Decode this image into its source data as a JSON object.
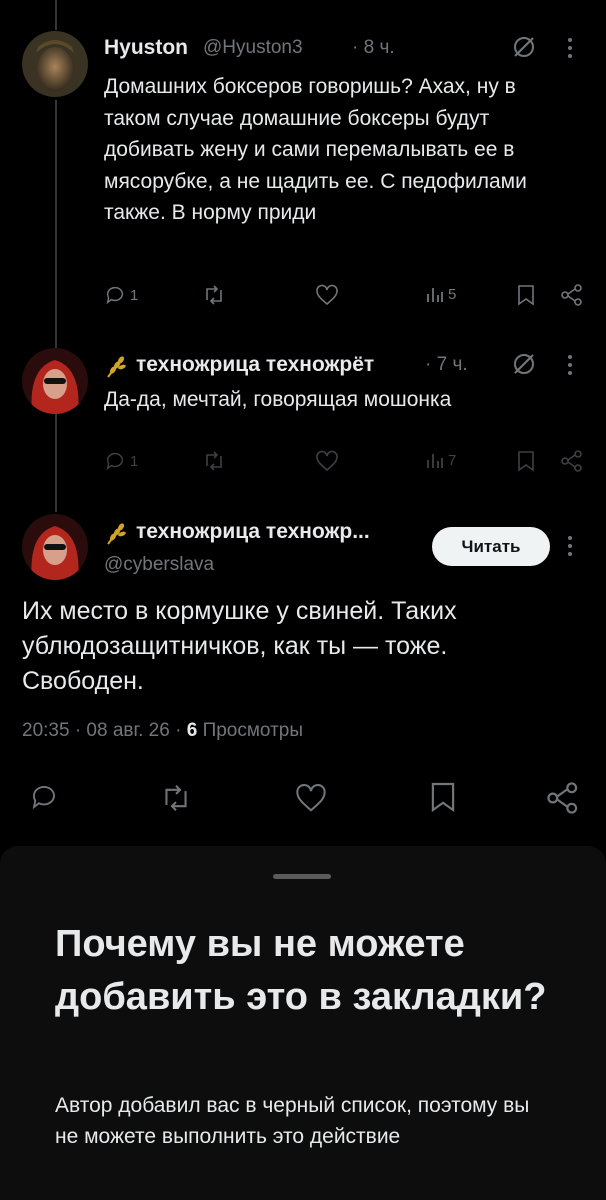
{
  "tweets": [
    {
      "name": "Hyuston",
      "handle": "@Hyuston3",
      "time": "· 8 ч.",
      "text": "Домашних боксеров говоришь? Ахах, ну в таком случае домашние боксеры будут добивать жену и сами перемалывать ее в мясорубке, а не щадить ее. С педофилами также. В норму приди",
      "replies": "1",
      "retweets": "",
      "likes": "",
      "views": "5"
    },
    {
      "name": "техножрица техножрёт",
      "time": "· 7 ч.",
      "text": "Да-да, мечтай, говорящая мошонка",
      "replies": "1",
      "retweets": "",
      "likes": "",
      "views": "7"
    }
  ],
  "main_tweet": {
    "name": "техножрица техножр...",
    "handle": "@cyberslava",
    "follow_label": "Читать",
    "text": "Их место в кормушке у свиней. Таких ублюдозащитничков, как ты — тоже. Свободен.",
    "time": "20:35 · 08 авг. 26 ·",
    "views_count": "6",
    "views_label": "Просмотры"
  },
  "sheet": {
    "title": "Почему вы не можете добавить это в закладки?",
    "description": "Автор добавил вас в черный список, поэтому вы не можете выполнить это действие"
  },
  "colors": {
    "background": "#000000",
    "text": "#e7e9ea",
    "muted": "#71767b",
    "sheet_bg": "#0d0d0d",
    "follow_bg": "#eff3f4"
  }
}
